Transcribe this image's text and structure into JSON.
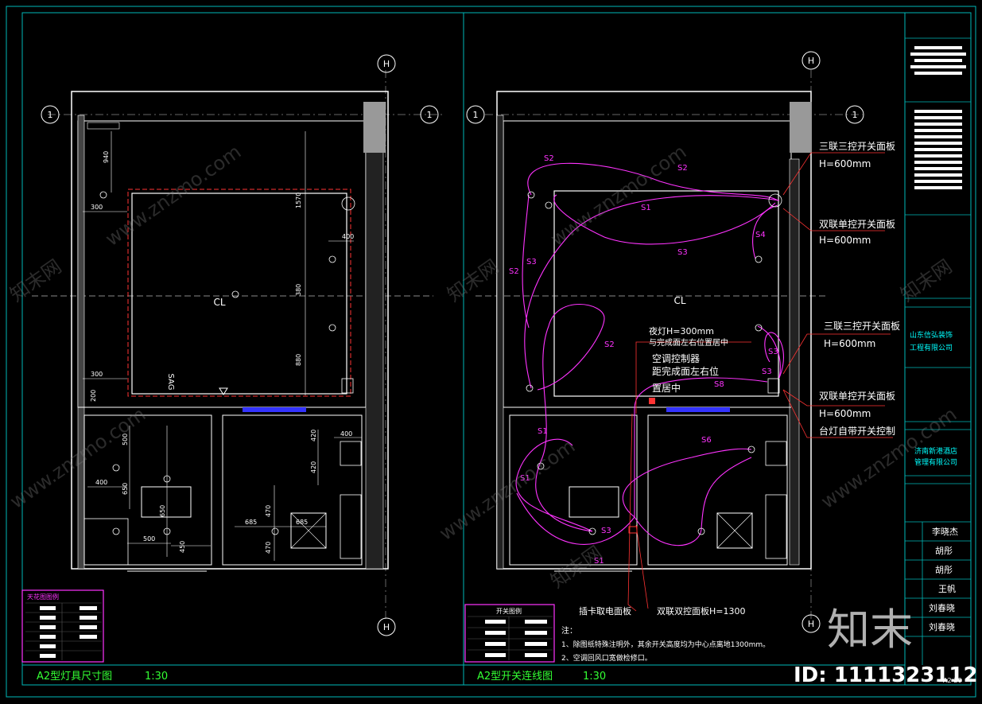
{
  "titles": {
    "left": "A2型灯具尺寸图",
    "left_scale": "1:30",
    "right": "A2型开关连线图",
    "right_scale": "1:30"
  },
  "axes": {
    "h": "H",
    "one": "1",
    "cl": "CL",
    "sag": "SAG"
  },
  "left_dims": [
    "940",
    "1570",
    "300",
    "400",
    "300",
    "500",
    "200",
    "650",
    "400",
    "650",
    "500",
    "450",
    "380",
    "880",
    "420",
    "400",
    "420",
    "685",
    "685",
    "470",
    "470"
  ],
  "switch_labels": {
    "a1": "三联三控开关面板",
    "a2": "H=600mm",
    "b1": "双联单控开关面板",
    "b2": "H=600mm",
    "c1": "三联三控开关面板",
    "c2": "H=600mm",
    "d1": "双联单控开关面板",
    "d2": "H=600mm",
    "d3": "台灯自带开关控制",
    "night1": "夜灯H=300mm",
    "night2": "与完成面左右位置居中",
    "ac1": "空调控制器",
    "ac2": "距完成面左右位",
    "ac3": "置居中",
    "card": "插卡取电面板",
    "double": "双联双控面板H=1300"
  },
  "circuits": [
    "S1",
    "S1",
    "S1",
    "S1",
    "S2",
    "S2",
    "S2",
    "S2",
    "S3",
    "S3",
    "S3",
    "S3",
    "S3",
    "S4",
    "S6",
    "S8"
  ],
  "notes": {
    "head": "注：",
    "n1": "1、除图纸特殊注明外，其余开关高度均为中心点离地1300mm。",
    "n2": "2、空调回风口宽做检修口。"
  },
  "legend_left": {
    "title": "天花图图例"
  },
  "legend_right": {
    "title": "开关图例"
  },
  "title_block": {
    "company1": "山东信弘装饰",
    "company2": "工程有限公司",
    "client1": "济南新港酒店",
    "client2": "管理有限公司",
    "sig1": "李晓杰",
    "sig2": "胡彤",
    "sig3": "胡彤",
    "sig4": "王帆",
    "sig5": "刘春晓",
    "sig6": "刘春晓",
    "sheet": "A2-20"
  },
  "watermark": {
    "brand": "知末",
    "id": "ID: 1111323112",
    "site": "www.znzmo.com",
    "site_cn": "知末网"
  },
  "colors": {
    "frame": "#00b8b8",
    "wall": "#ffffff",
    "dim": "#ffffff",
    "magenta": "#ff33ff",
    "red": "#ff3333",
    "grid": "#3a3a3a",
    "green": "#33ff33",
    "cyan": "#00ffff",
    "yellow": "#ffff00",
    "blue": "#3333ff"
  }
}
